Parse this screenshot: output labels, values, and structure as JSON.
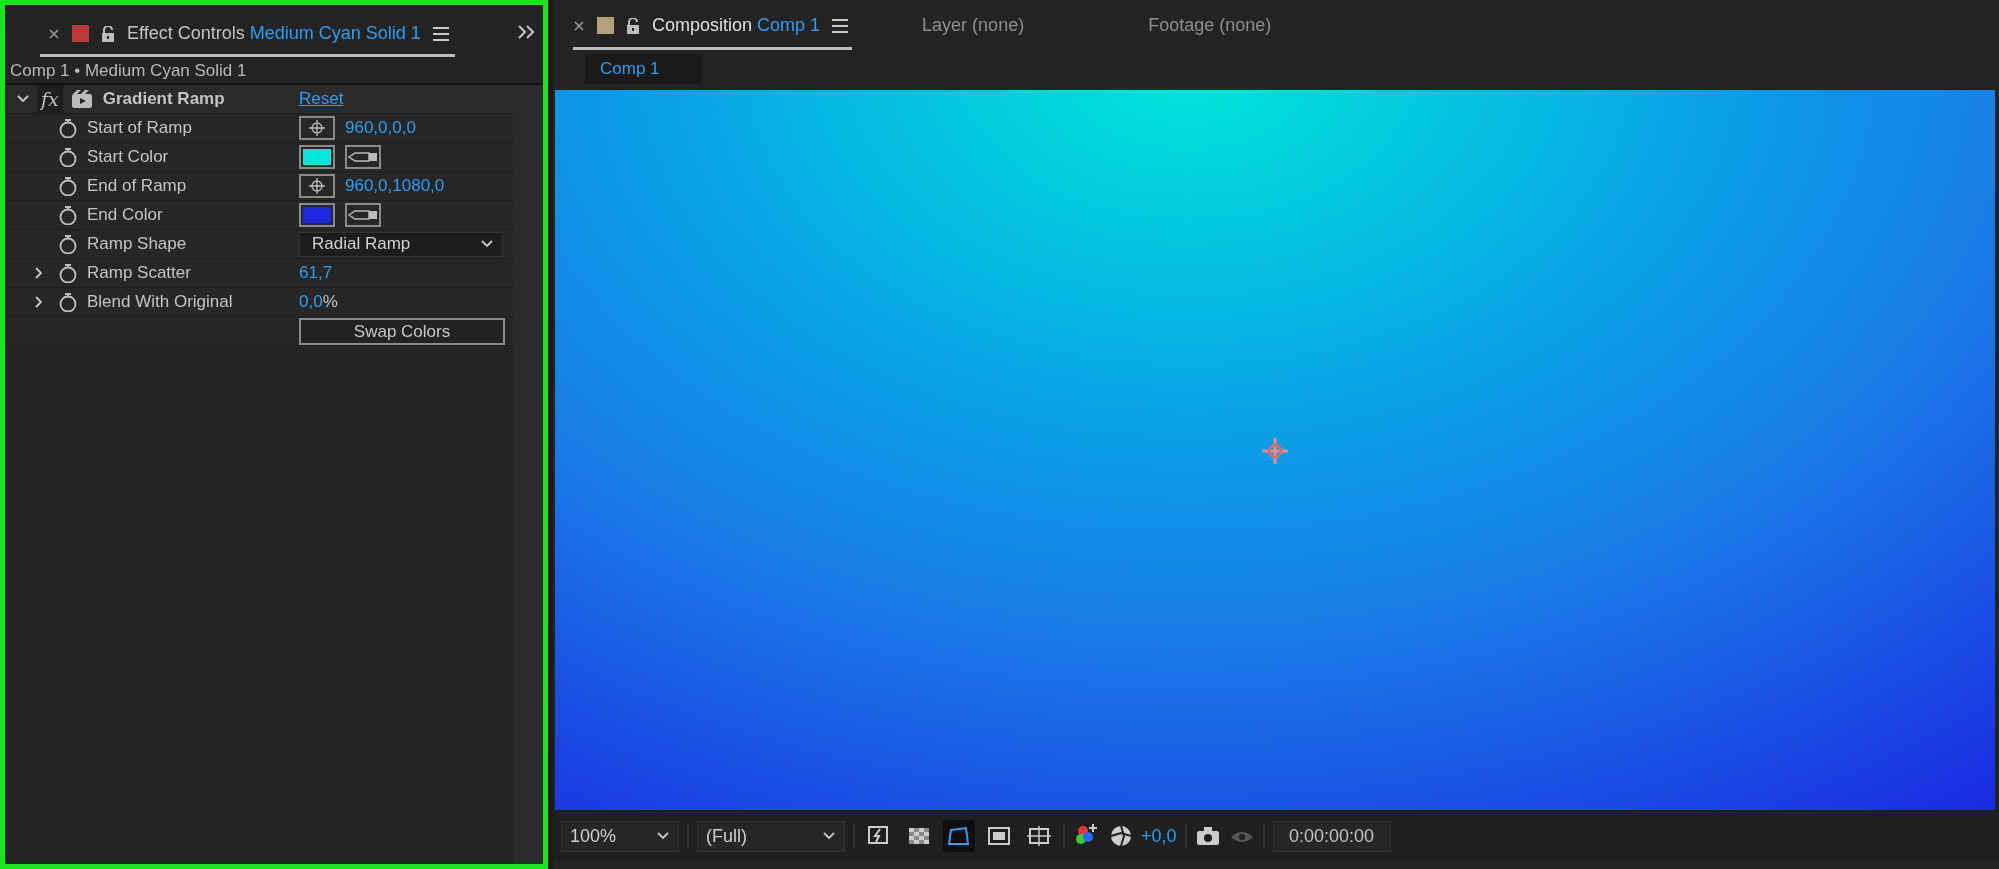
{
  "effect_controls": {
    "tab": {
      "title": "Effect Controls",
      "layer": "Medium Cyan Solid 1",
      "color": "#b83c3c",
      "selected": true
    },
    "breadcrumb": "Comp 1 • Medium Cyan Solid 1",
    "effect": {
      "badge": "fx",
      "name": "Gradient Ramp",
      "reset": "Reset",
      "expanded": true
    },
    "properties": [
      {
        "kind": "point",
        "name": "Start of Ramp",
        "value": "960,0,0,0",
        "twirl": false
      },
      {
        "kind": "color",
        "name": "Start Color",
        "color": "#00e8d8",
        "twirl": false
      },
      {
        "kind": "point",
        "name": "End of Ramp",
        "value": "960,0,1080,0",
        "twirl": false
      },
      {
        "kind": "color",
        "name": "End Color",
        "color": "#1a28e0",
        "twirl": false
      },
      {
        "kind": "dropdown",
        "name": "Ramp Shape",
        "value": "Radial Ramp",
        "twirl": false
      },
      {
        "kind": "number",
        "name": "Ramp Scatter",
        "value": "61,7",
        "twirl": true
      },
      {
        "kind": "number",
        "name": "Blend With Original",
        "value": "0,0",
        "unit": "%",
        "twirl": true
      },
      {
        "kind": "button",
        "label": "Swap Colors",
        "twirl": false
      }
    ]
  },
  "composition": {
    "tabs": [
      {
        "title": "Composition",
        "name": "Comp 1",
        "color": "#b5a07c",
        "selected": true
      },
      {
        "title": "Layer",
        "name": "(none)",
        "selected": false
      },
      {
        "title": "Footage",
        "name": "(none)",
        "selected": false
      }
    ],
    "sub_tab": "Comp 1",
    "toolbar": {
      "zoom": "100%",
      "resolution": "(Full)",
      "exposure": "+0,0",
      "timecode": "0:00:00:00",
      "toggles": [
        {
          "on": false
        },
        {
          "on": false
        },
        {
          "on": true
        },
        {
          "on": false
        },
        {
          "on": false
        }
      ]
    }
  }
}
